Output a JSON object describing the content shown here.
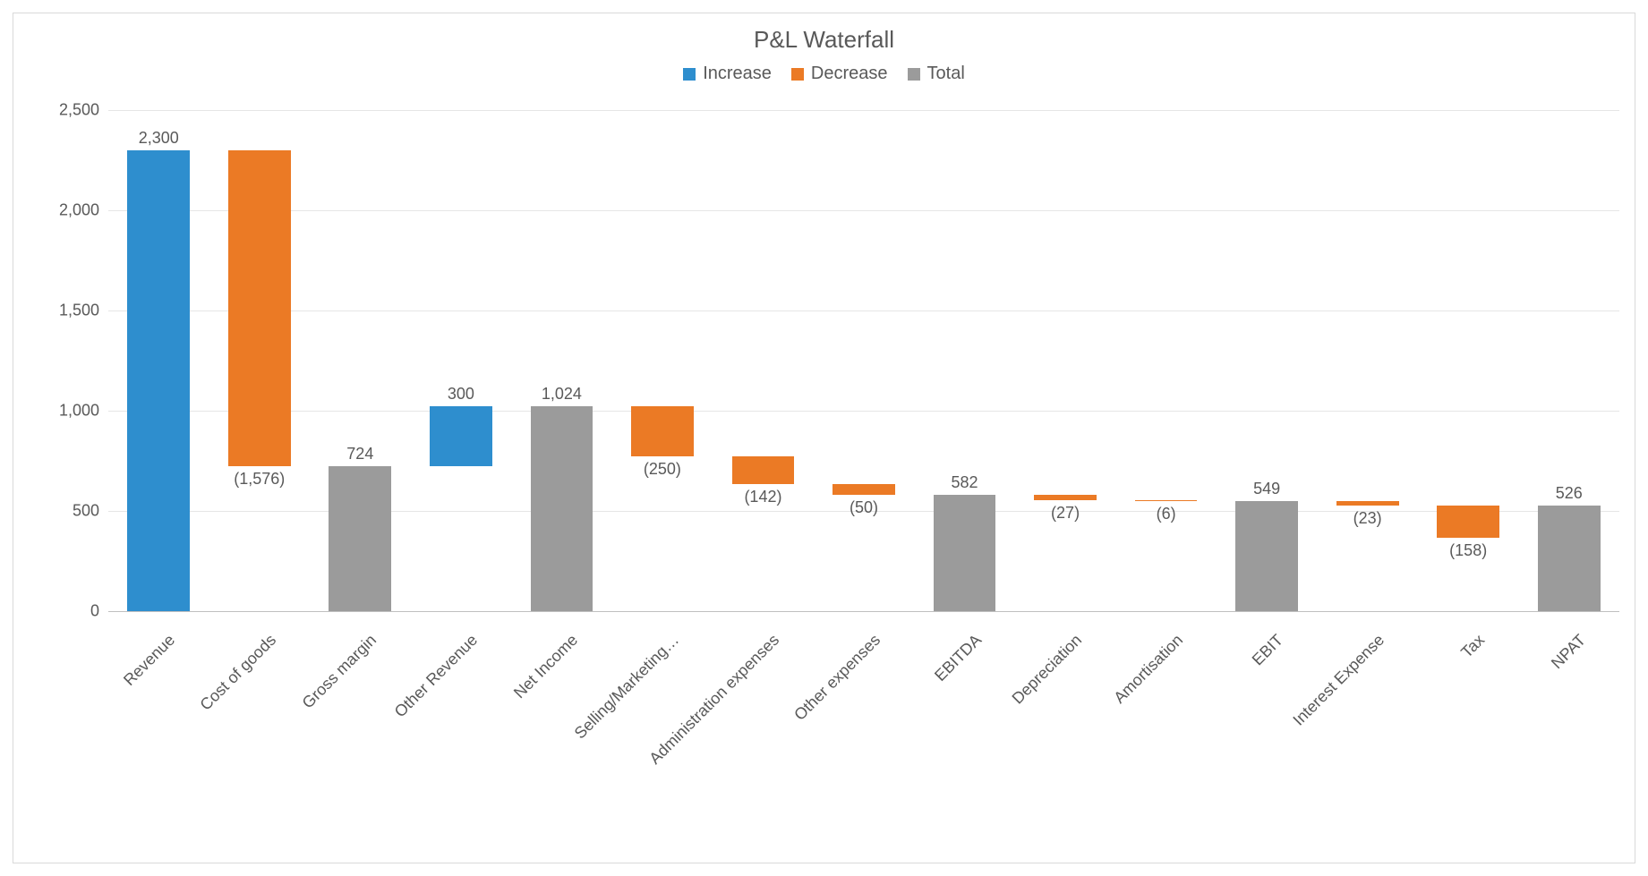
{
  "title": "P&L Waterfall",
  "legend": {
    "increase": "Increase",
    "decrease": "Decrease",
    "total": "Total"
  },
  "colors": {
    "increase": "#2e8ece",
    "decrease": "#eb7a25",
    "total": "#9b9b9b"
  },
  "y_ticks": [
    "0",
    "500",
    "1,000",
    "1,500",
    "2,000",
    "2,500"
  ],
  "categories": [
    "Revenue",
    "Cost of goods",
    "Gross margin",
    "Other Revenue",
    "Net Income",
    "Selling/Marketing…",
    "Administration expenses",
    "Other expenses",
    "EBITDA",
    "Depreciation",
    "Amortisation",
    "EBIT",
    "Interest Expense",
    "Tax",
    "NPAT"
  ],
  "labels": [
    "2,300",
    "(1,576)",
    "724",
    "300",
    "1,024",
    "(250)",
    "(142)",
    "(50)",
    "582",
    "(27)",
    "(6)",
    "549",
    "(23)",
    "(158)",
    "526"
  ],
  "chart_data": {
    "type": "waterfall",
    "title": "P&L Waterfall",
    "xlabel": "",
    "ylabel": "",
    "ylim": [
      0,
      2500
    ],
    "legend": [
      "Increase",
      "Decrease",
      "Total"
    ],
    "categories": [
      "Revenue",
      "Cost of goods",
      "Gross margin",
      "Other Revenue",
      "Net Income",
      "Selling/Marketing…",
      "Administration expenses",
      "Other expenses",
      "EBITDA",
      "Depreciation",
      "Amortisation",
      "EBIT",
      "Interest Expense",
      "Tax",
      "NPAT"
    ],
    "steps": [
      {
        "name": "Revenue",
        "type": "increase",
        "value": 2300,
        "start": 0,
        "end": 2300
      },
      {
        "name": "Cost of goods",
        "type": "decrease",
        "value": -1576,
        "start": 2300,
        "end": 724
      },
      {
        "name": "Gross margin",
        "type": "total",
        "value": 724,
        "start": 0,
        "end": 724
      },
      {
        "name": "Other Revenue",
        "type": "increase",
        "value": 300,
        "start": 724,
        "end": 1024
      },
      {
        "name": "Net Income",
        "type": "total",
        "value": 1024,
        "start": 0,
        "end": 1024
      },
      {
        "name": "Selling/Marketing…",
        "type": "decrease",
        "value": -250,
        "start": 1024,
        "end": 774
      },
      {
        "name": "Administration expenses",
        "type": "decrease",
        "value": -142,
        "start": 774,
        "end": 632
      },
      {
        "name": "Other expenses",
        "type": "decrease",
        "value": -50,
        "start": 632,
        "end": 582
      },
      {
        "name": "EBITDA",
        "type": "total",
        "value": 582,
        "start": 0,
        "end": 582
      },
      {
        "name": "Depreciation",
        "type": "decrease",
        "value": -27,
        "start": 582,
        "end": 555
      },
      {
        "name": "Amortisation",
        "type": "decrease",
        "value": -6,
        "start": 555,
        "end": 549
      },
      {
        "name": "EBIT",
        "type": "total",
        "value": 549,
        "start": 0,
        "end": 549
      },
      {
        "name": "Interest Expense",
        "type": "decrease",
        "value": -23,
        "start": 549,
        "end": 526
      },
      {
        "name": "Tax",
        "type": "decrease",
        "value": -158,
        "start": 526,
        "end": 368
      },
      {
        "name": "NPAT",
        "type": "total",
        "value": 526,
        "start": 0,
        "end": 526
      }
    ]
  }
}
